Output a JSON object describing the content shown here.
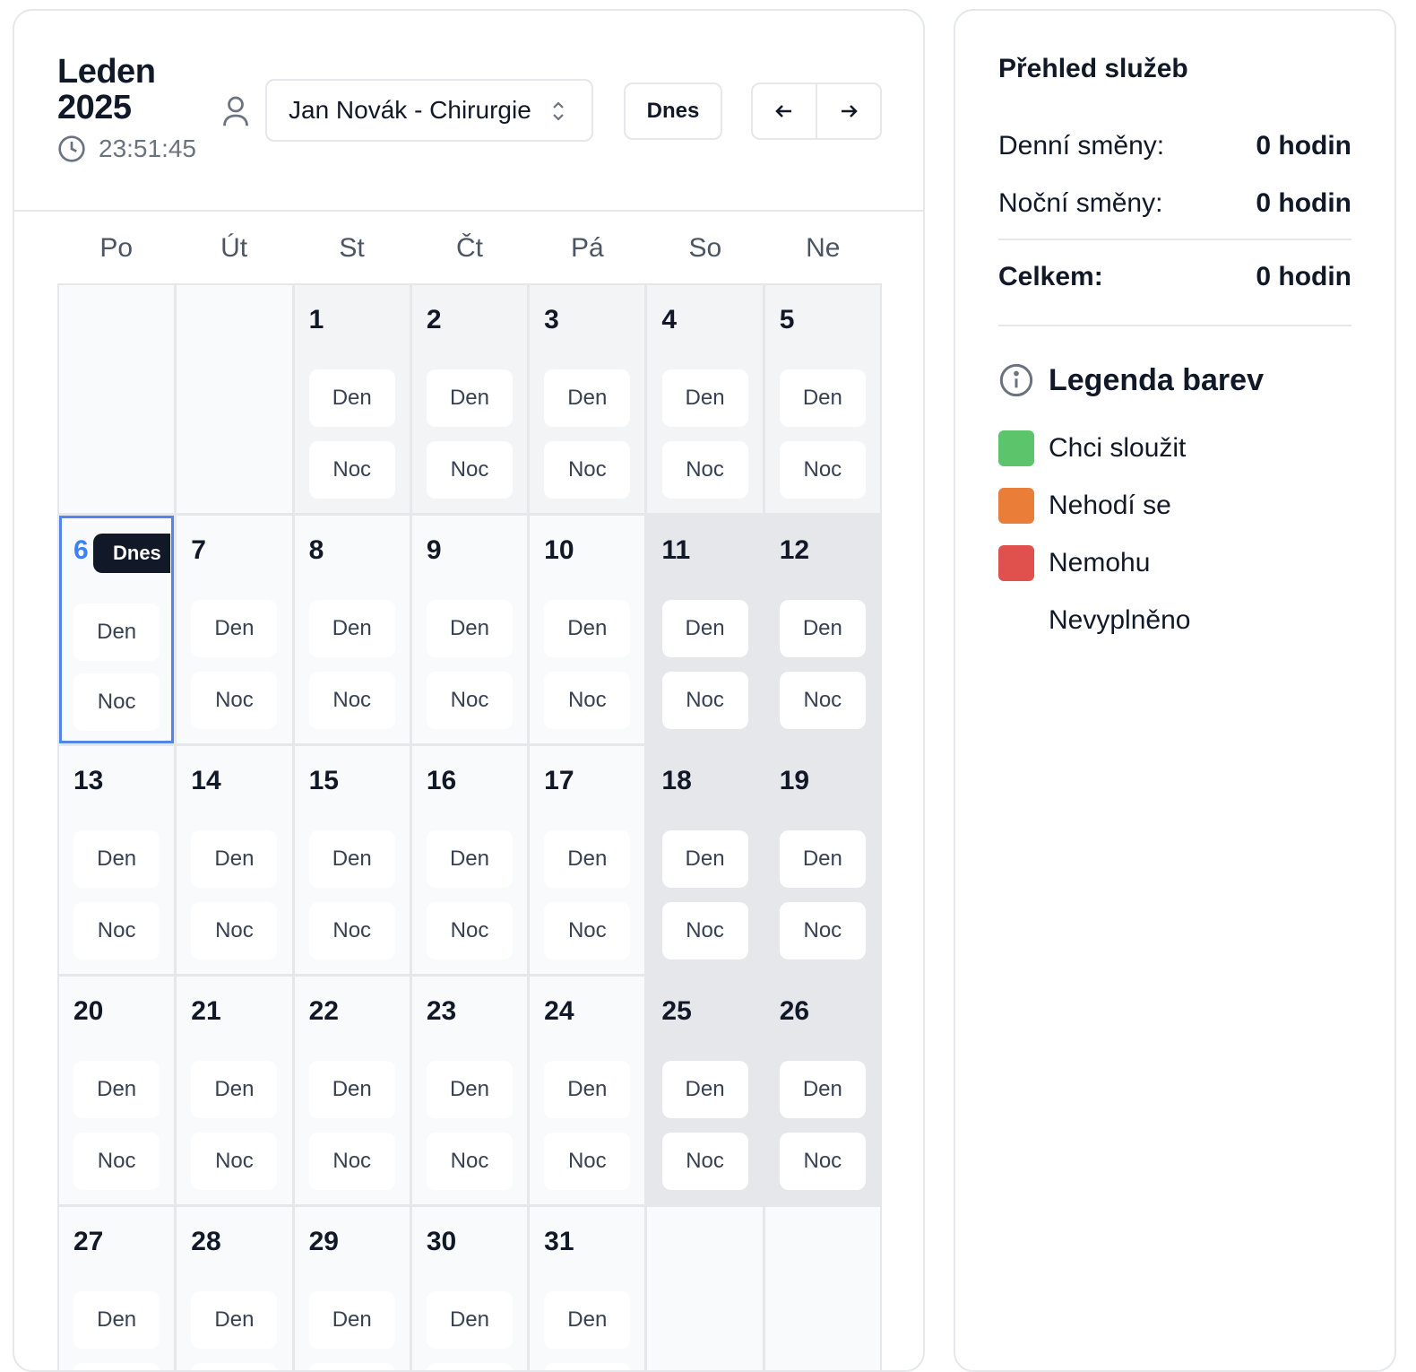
{
  "calendar": {
    "month_title": "Leden 2025",
    "clock": "23:51:45",
    "doctor_select": "Jan Novák - Chirurgie",
    "today_button": "Dnes",
    "today_badge": "Dnes",
    "weekdays": [
      "Po",
      "Út",
      "St",
      "Čt",
      "Pá",
      "So",
      "Ne"
    ],
    "shift_day_label": "Den",
    "shift_night_label": "Noc",
    "today_day": "6",
    "days": [
      "1",
      "2",
      "3",
      "4",
      "5",
      "6",
      "7",
      "8",
      "9",
      "10",
      "11",
      "12",
      "13",
      "14",
      "15",
      "16",
      "17",
      "18",
      "19",
      "20",
      "21",
      "22",
      "23",
      "24",
      "25",
      "26",
      "27",
      "28",
      "29",
      "30",
      "31"
    ]
  },
  "summary": {
    "title": "Přehled služeb",
    "day_shifts_label": "Denní směny:",
    "day_shifts_value": "0 hodin",
    "night_shifts_label": "Noční směny:",
    "night_shifts_value": "0 hodin",
    "total_label": "Celkem:",
    "total_value": "0 hodin"
  },
  "legend": {
    "title": "Legenda barev",
    "items": [
      {
        "label": "Chci sloužit",
        "color": "#5cc46a"
      },
      {
        "label": "Nehodí se",
        "color": "#ea7d38"
      },
      {
        "label": "Nemohu",
        "color": "#e0514d"
      },
      {
        "label": "Nevyplněno",
        "color": "#ffffff"
      }
    ]
  },
  "icons": {
    "clock": "clock-icon",
    "person": "person-icon",
    "select_chevron": "chevron-up-down-icon",
    "prev": "arrow-left-icon",
    "next": "arrow-right-icon",
    "info": "info-icon"
  }
}
